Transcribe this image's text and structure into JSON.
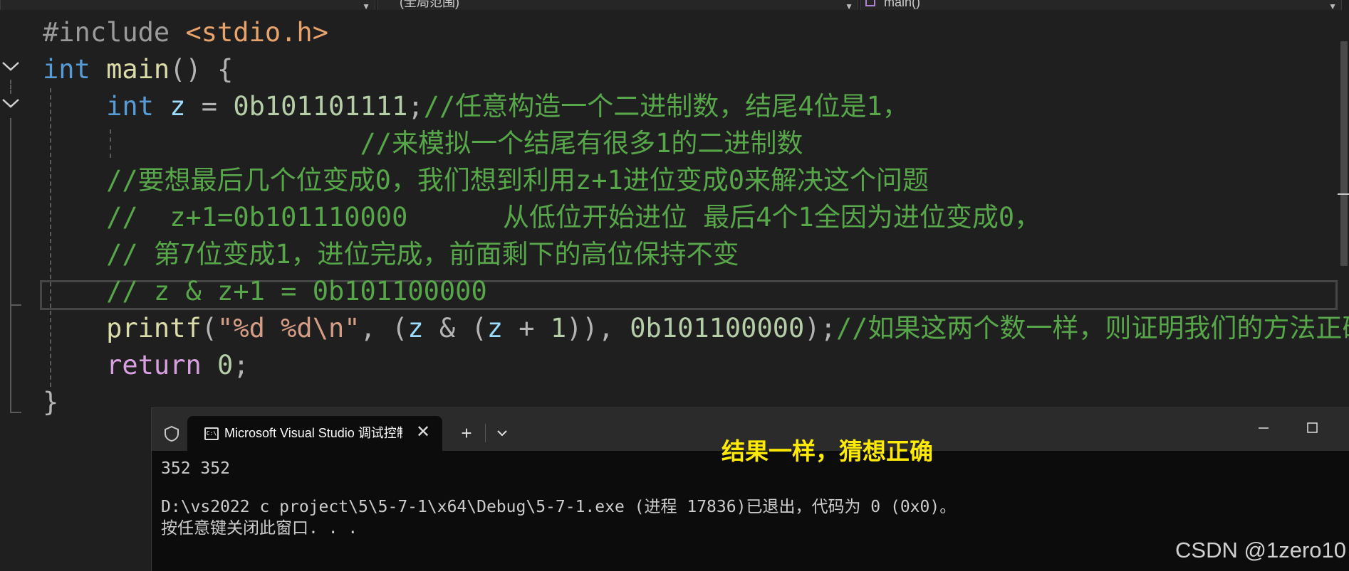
{
  "navbar": {
    "scope_label": "",
    "member_label": "(全局范围)",
    "function_label": "main()"
  },
  "code": {
    "l1": {
      "pre": "#include ",
      "inc": "<stdio.h>"
    },
    "l2": {
      "kw": "int",
      "sp": " ",
      "fn": "main",
      "rest": "() {"
    },
    "l3": {
      "indent": "    ",
      "kw": "int",
      "sp1": " ",
      "var": "z",
      "op": " = ",
      "num": "0b101101111",
      "semi": ";",
      "cmt": "//任意构造一个二进制数，结尾4位是1，"
    },
    "l4": {
      "indent": "                    ",
      "cmt": "//来模拟一个结尾有很多1的二进制数"
    },
    "l5": {
      "indent": "    ",
      "cmt": "//要想最后几个位变成0，我们想到利用z+1进位变成0来解决这个问题"
    },
    "l6": {
      "indent": "    ",
      "cmt": "//  z+1=0b101110000      从低位开始进位 最后4个1全因为进位变成0，"
    },
    "l7": {
      "indent": "    ",
      "cmt": "// 第7位变成1，进位完成，前面剩下的高位保持不变"
    },
    "l8": {
      "indent": "    ",
      "cmt": "// z & z+1 = 0b101100000"
    },
    "l9": {
      "indent": "    ",
      "fn": "printf",
      "p1": "(",
      "str": "\"%d %d\\n\"",
      "c1": ", (",
      "v1": "z",
      "op1": " & (",
      "v2": "z",
      "op2": " + ",
      "n1": "1",
      "p2": ")), ",
      "n2": "0b101100000",
      "p3": ");",
      "cmt": "//如果这两个数一样，则证明我们的方法正确"
    },
    "l10": {
      "indent": "    ",
      "kw": "return",
      "sp": " ",
      "num": "0",
      "semi": ";"
    },
    "l11": {
      "brace": "}"
    }
  },
  "console": {
    "tab_title": "Microsoft Visual Studio 调试控制台",
    "new_tab_label": "+",
    "dropdown_label": "⌄",
    "close_label": "✕",
    "annotation": "结果一样，猜想正确",
    "output_line1": "352 352",
    "output_line2": "D:\\vs2022 c project\\5\\5-7-1\\x64\\Debug\\5-7-1.exe (进程 17836)已退出，代码为 0 (0x0)。",
    "output_line3": "按任意键关闭此窗口. . ."
  },
  "watermark": "CSDN @1zero10"
}
